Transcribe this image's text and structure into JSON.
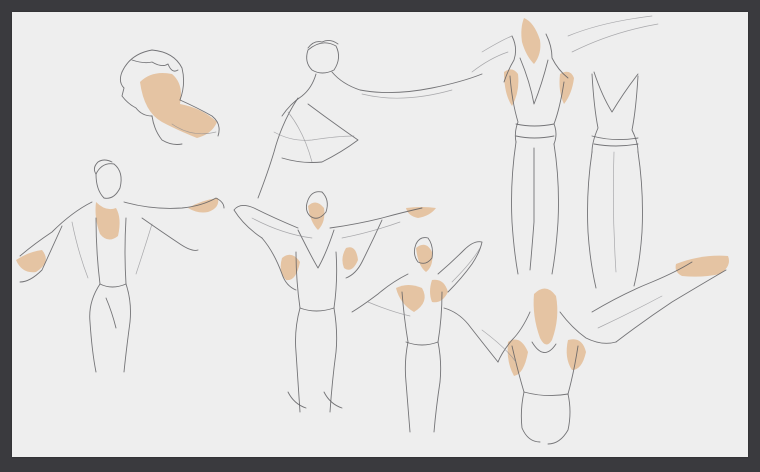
{
  "artwork": {
    "colors": {
      "background": "#3a3a3e",
      "paper": "#eeeeee",
      "pencil": "#5e5e62",
      "ochre_wash": "#e2b58a"
    }
  }
}
